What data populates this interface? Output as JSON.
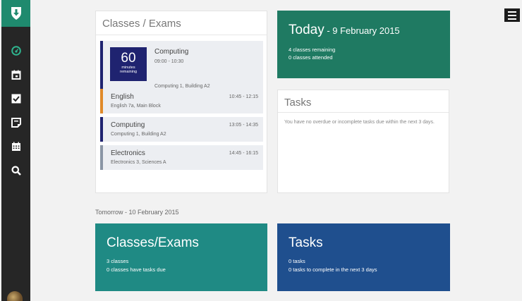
{
  "sidebar": {
    "logo_icon": "shield-download-icon",
    "items": [
      {
        "icon": "dashboard-icon",
        "color": "#2fb58f"
      },
      {
        "icon": "calendar-day-icon",
        "color": "#ffffff"
      },
      {
        "icon": "checkbox-icon",
        "color": "#ffffff"
      },
      {
        "icon": "sticky-note-icon",
        "color": "#ffffff"
      },
      {
        "icon": "calendar-grid-icon",
        "color": "#ffffff"
      },
      {
        "icon": "search-icon",
        "color": "#ffffff"
      }
    ]
  },
  "classes_panel": {
    "title": "Classes / Exams",
    "current": {
      "minutes": "60",
      "minutes_label_1": "minutes",
      "minutes_label_2": "remaining",
      "name": "Computing",
      "time": "09:00 - 10:30",
      "location": "Computing 1, Building A2"
    },
    "items": [
      {
        "name": "English",
        "location": "English 7a, Main Block",
        "time": "10:45 - 12:15",
        "color": "#e08a2a"
      },
      {
        "name": "Computing",
        "location": "Computing 1, Building A2",
        "time": "13:05 - 14:35",
        "color": "#1f2370"
      },
      {
        "name": "Electronics",
        "location": "Electronics 3, Sciences A",
        "time": "14:45 - 16:15",
        "color": "#8a95a5"
      }
    ]
  },
  "today": {
    "label": "Today",
    "date": " - 9 February 2015",
    "remaining": "4 classes remaining",
    "attended": "0 classes attended"
  },
  "tasks_panel": {
    "title": "Tasks",
    "message": "You have no overdue or incomplete tasks due within the next 3 days."
  },
  "tomorrow": {
    "heading": "Tomorrow - 10 February 2015",
    "classes_tile": {
      "title": "Classes/Exams",
      "line1": "3 classes",
      "line2": "0 classes have tasks due"
    },
    "tasks_tile": {
      "title": "Tasks",
      "line1": "0 tasks",
      "line2": "0 tasks to complete in the next 3 days"
    }
  },
  "colors": {
    "today_tile": "#1f7a62",
    "classes_tile": "#1f8a84",
    "tasks_tile": "#1f4f8e",
    "brand": "#1f8a6e"
  }
}
